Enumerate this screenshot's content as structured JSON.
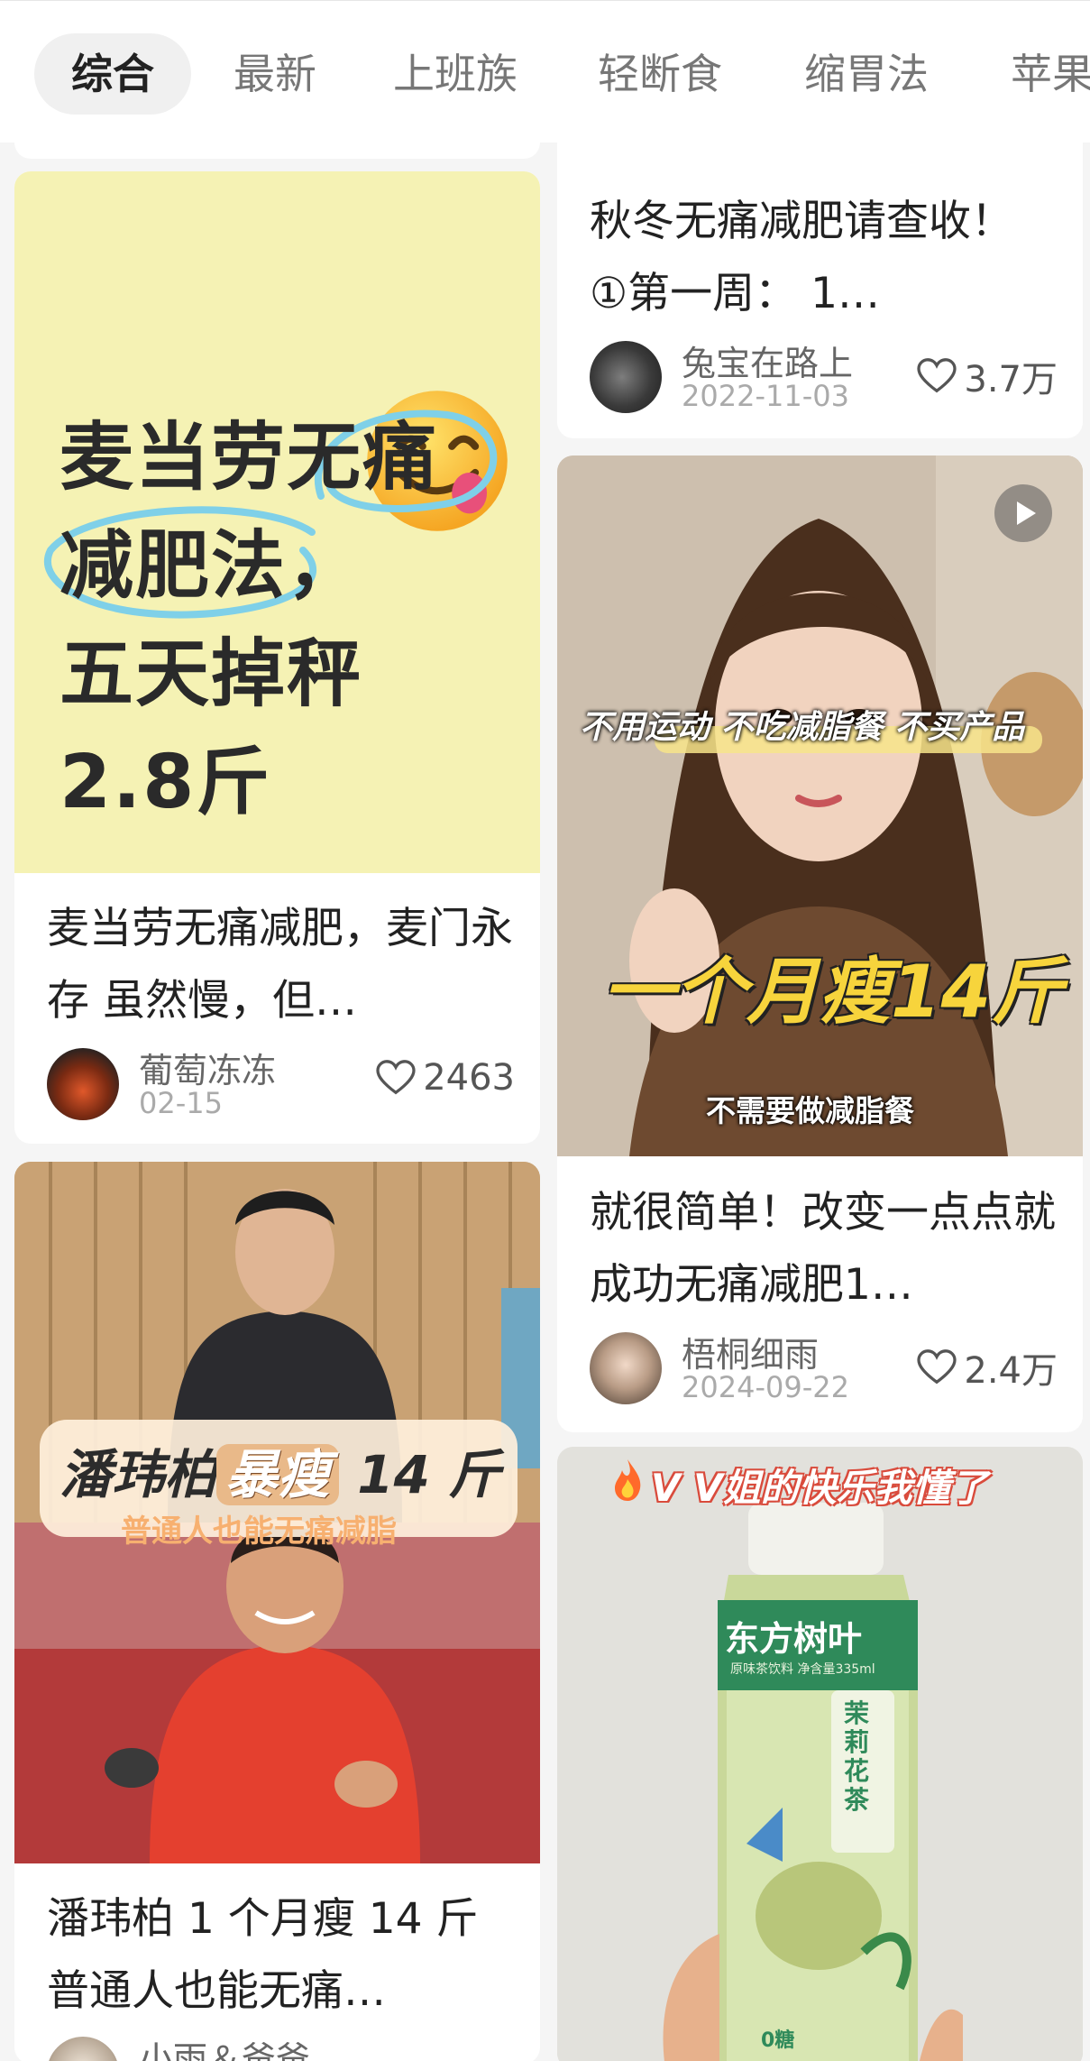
{
  "tabs": [
    {
      "label": "综合",
      "active": true
    },
    {
      "label": "最新",
      "active": false
    },
    {
      "label": "上班族",
      "active": false
    },
    {
      "label": "轻断食",
      "active": false
    },
    {
      "label": "缩胃法",
      "active": false
    },
    {
      "label": "苹果",
      "active": false
    }
  ],
  "cards": {
    "mcd": {
      "cover_lines": [
        "麦当劳无痛",
        "减肥法，",
        "五天掉秤",
        "2.8斤"
      ],
      "title": "麦当劳无痛减肥，麦门永存 虽然慢，但…",
      "author": "葡萄冻冻",
      "date": "02-15",
      "likes": "2463"
    },
    "autumn": {
      "title": "秋冬无痛减肥请查收！ ①第一周： 1…",
      "author": "兔宝在路上",
      "date": "2022-11-03",
      "likes": "3.7万"
    },
    "video": {
      "caption_top": "不用运动 不吃减脂餐 不买产品",
      "caption_big": "一个月瘦14斤",
      "caption_bottom": "不需要做减脂餐",
      "title": "就很简单！改变一点点就成功无痛减肥1…",
      "author": "梧桐细雨",
      "date": "2024-09-22",
      "likes": "2.4万"
    },
    "pan": {
      "banner_prefix": "潘玮柏",
      "banner_highlight": "暴瘦",
      "banner_suffix": " 14 斤",
      "banner_sub": "普通人也能无痛减脂",
      "title": "潘玮柏 1 个月瘦 14 斤 普通人也能无痛…",
      "author": "小雨＆爸爸…",
      "date": "",
      "likes": ""
    },
    "tea": {
      "caption": "V V姐的快乐我懂了",
      "bottle_brand": "东方树叶",
      "bottle_sub": "茉莉花茶",
      "bottle_small": "原味茶饮料 净含量335ml",
      "zero_sugar": "0糖"
    }
  },
  "colors": {
    "accent_yellow": "#f7d43c",
    "mcd_bg": "#f5f2b4",
    "circle_blue": "#7fd0e8"
  },
  "icons": {
    "like": "heart-outline-icon",
    "play": "play-icon",
    "fire": "fire-icon"
  }
}
